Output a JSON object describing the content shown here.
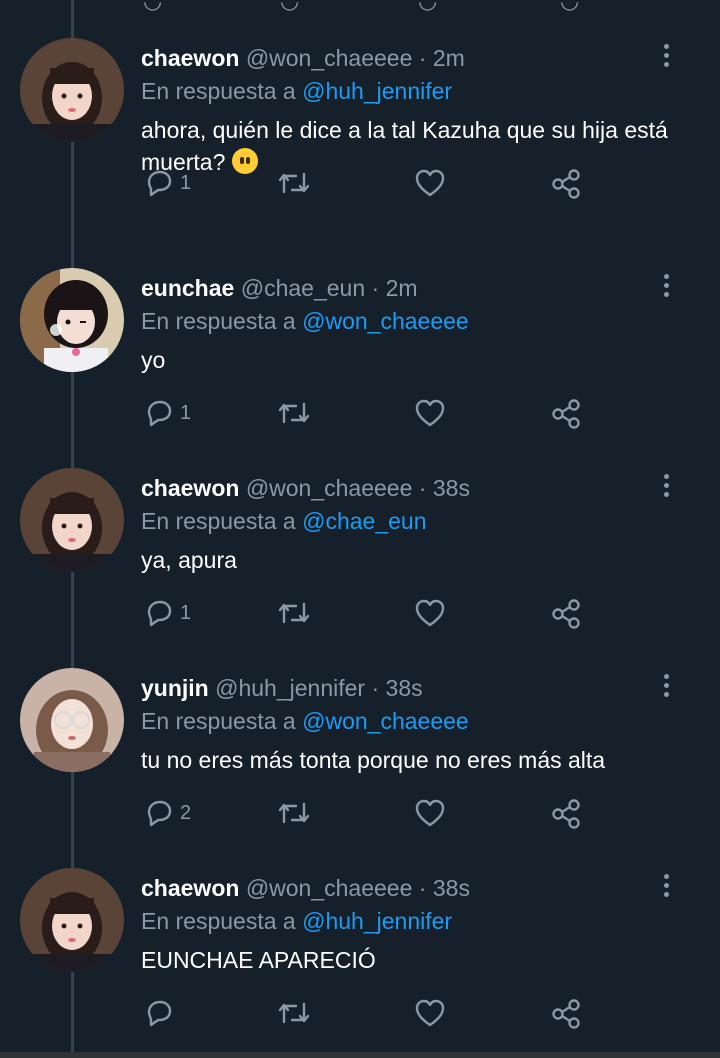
{
  "tweets": [
    {
      "name": "chaewon",
      "handle": "@won_chaeeee",
      "time": "2m",
      "reply_prefix": "En respuesta a",
      "reply_to": "@huh_jennifer",
      "text": "ahora, quién le dice a la tal Kazuha que su hija está muerta?",
      "emoji": "face-without-mouth-emoji",
      "reply_count": "1"
    },
    {
      "name": "eunchae",
      "handle": "@chae_eun",
      "time": "2m",
      "reply_prefix": "En respuesta a",
      "reply_to": "@won_chaeeee",
      "text": "yo",
      "reply_count": "1"
    },
    {
      "name": "chaewon",
      "handle": "@won_chaeeee",
      "time": "38s",
      "reply_prefix": "En respuesta a",
      "reply_to": "@chae_eun",
      "text": "ya, apura",
      "reply_count": "1"
    },
    {
      "name": "yunjin",
      "handle": "@huh_jennifer",
      "time": "38s",
      "reply_prefix": "En respuesta a",
      "reply_to": "@won_chaeeee",
      "text": "tu no eres más tonta porque no eres más alta",
      "reply_count": "2"
    },
    {
      "name": "chaewon",
      "handle": "@won_chaeeee",
      "time": "38s",
      "reply_prefix": "En respuesta a",
      "reply_to": "@huh_jennifer",
      "text": "EUNCHAE APARECIÓ",
      "reply_count": ""
    }
  ],
  "separator": "·",
  "icons": {
    "reply": "reply-icon",
    "retweet": "retweet-icon",
    "like": "like-icon",
    "share": "share-icon",
    "more": "more-options-icon"
  },
  "colors": {
    "background": "#15202b",
    "muted": "#8b98a5",
    "link": "#1d9bf0"
  }
}
